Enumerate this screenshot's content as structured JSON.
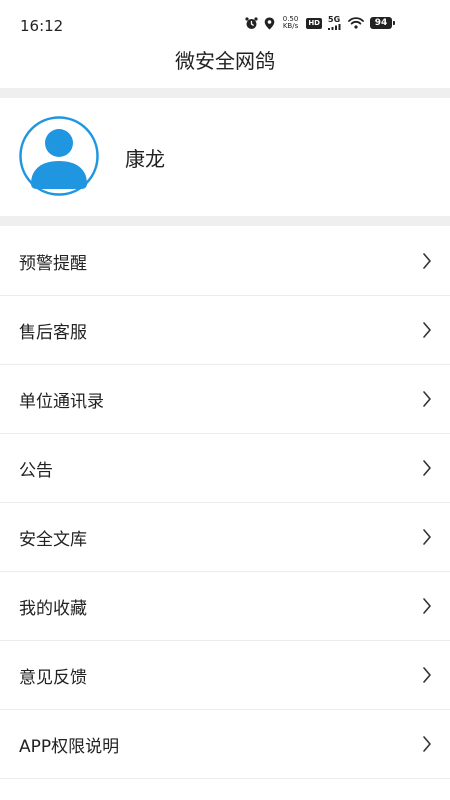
{
  "status_bar": {
    "time": "16:12",
    "speed_value": "0.50",
    "speed_unit": "KB/s",
    "hd_label": "HD",
    "network_label": "5G",
    "battery_level": "94",
    "icons": [
      "alarm-icon",
      "location-icon",
      "signal-icon",
      "wifi-icon",
      "battery-icon"
    ]
  },
  "header": {
    "title": "微安全网鸽"
  },
  "profile": {
    "name": "康龙",
    "avatar_color": "#2196e0"
  },
  "menu": {
    "items": [
      {
        "label": "预警提醒"
      },
      {
        "label": "售后客服"
      },
      {
        "label": "单位通讯录"
      },
      {
        "label": "公告"
      },
      {
        "label": "安全文库"
      },
      {
        "label": "我的收藏"
      },
      {
        "label": "意见反馈"
      },
      {
        "label": "APP权限说明"
      }
    ]
  },
  "colors": {
    "separator": "#efefef",
    "accent": "#2196e0",
    "text": "#222222"
  }
}
